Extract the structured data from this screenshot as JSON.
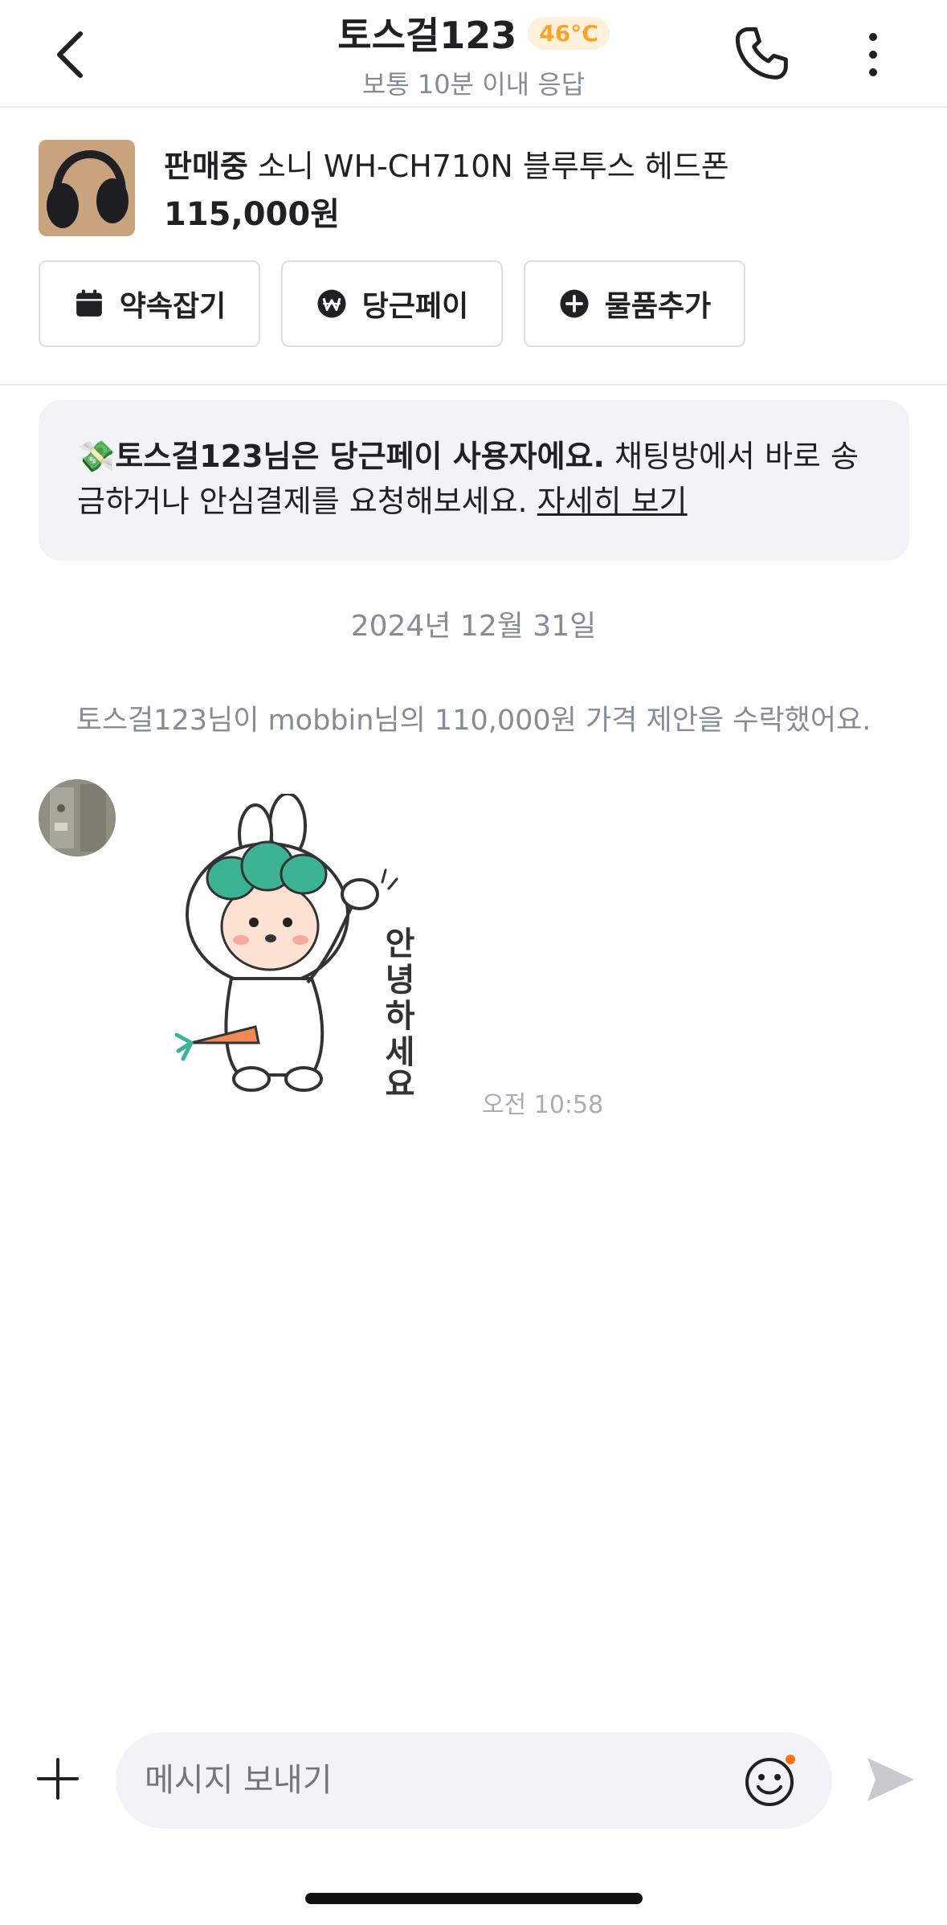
{
  "header": {
    "title": "토스걸123",
    "temperature": "46°C",
    "subtitle": "보통 10분 이내 응답",
    "accent_color": "#f6a52a"
  },
  "product": {
    "status": "판매중",
    "name": "소니 WH-CH710N 블루투스 헤드폰",
    "price": "115,000원",
    "actions": [
      {
        "label": "약속잡기",
        "icon": "calendar-icon"
      },
      {
        "label": "당근페이",
        "icon": "won-coin-icon"
      },
      {
        "label": "물품추가",
        "icon": "plus-circle-icon"
      }
    ]
  },
  "banner": {
    "emoji": "💸",
    "bold_text": "토스걸123님은 당근페이 사용자에요.",
    "text": " 채팅방에서 바로 송금하거나 안심결제를 요청해보세요. ",
    "link": "자세히 보기"
  },
  "chat": {
    "date": "2024년 12월 31일",
    "system_message": "토스걸123님이 mobbin님의 110,000원 가격 제안을 수락했어요.",
    "sticker_text": "안녕하세요",
    "time": "오전 10:58"
  },
  "composer": {
    "placeholder": "메시지 보내기",
    "notification_dot_color": "#ff6f0f"
  }
}
